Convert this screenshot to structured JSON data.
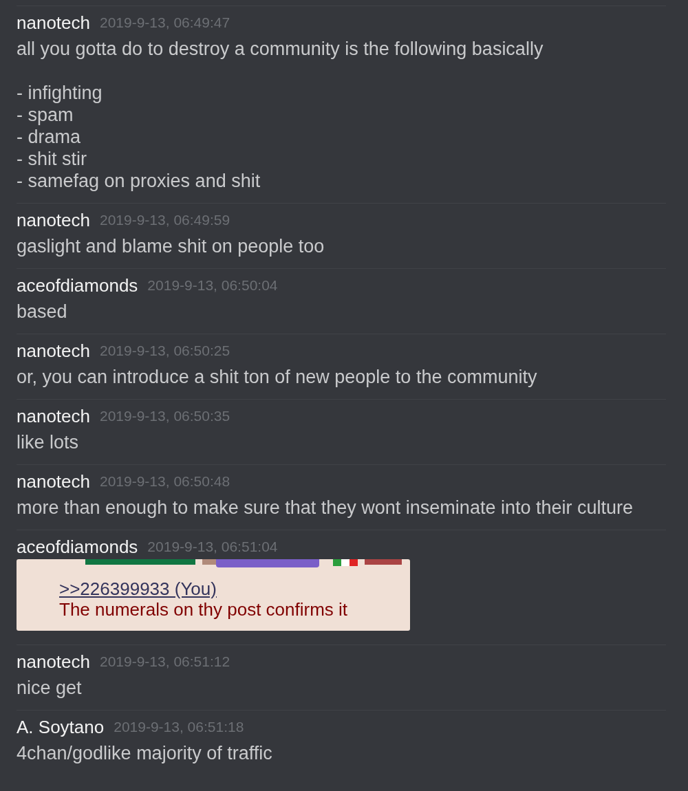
{
  "messages": [
    {
      "author": "nanotech",
      "time": "2019-9-13, 06:49:47",
      "kind": "text",
      "text": "all you gotta do to destroy a community is the following basically\n\n- infighting\n- spam\n- drama\n- shit stir\n- samefag on proxies and shit"
    },
    {
      "author": "nanotech",
      "time": "2019-9-13, 06:49:59",
      "kind": "text",
      "text": "gaslight and blame shit on people too"
    },
    {
      "author": "aceofdiamonds",
      "time": "2019-9-13, 06:50:04",
      "kind": "text",
      "text": "based"
    },
    {
      "author": "nanotech",
      "time": "2019-9-13, 06:50:25",
      "kind": "text",
      "text": "or, you can introduce a shit ton of new people to the community"
    },
    {
      "author": "nanotech",
      "time": "2019-9-13, 06:50:35",
      "kind": "text",
      "text": "like lots"
    },
    {
      "author": "nanotech",
      "time": "2019-9-13, 06:50:48",
      "kind": "text",
      "text": "more than enough to make sure that they wont inseminate into their culture"
    },
    {
      "author": "aceofdiamonds",
      "time": "2019-9-13, 06:51:04",
      "kind": "image",
      "image": {
        "link": ">>226399933 (You)",
        "text": "The numerals on thy post confirms it"
      }
    },
    {
      "author": "nanotech",
      "time": "2019-9-13, 06:51:12",
      "kind": "text",
      "text": "nice get"
    },
    {
      "author": "A. Soytano",
      "time": "2019-9-13, 06:51:18",
      "kind": "text",
      "text": "4chan/godlike majority of traffic"
    }
  ]
}
